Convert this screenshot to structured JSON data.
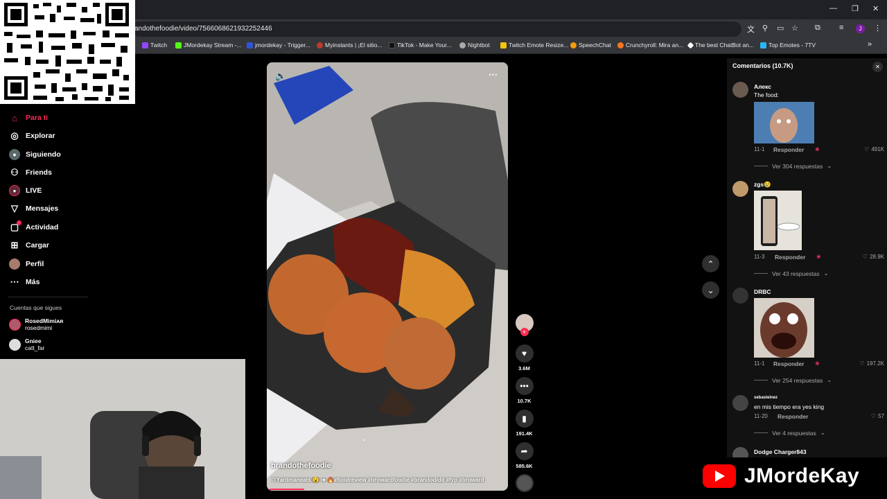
{
  "browser": {
    "url": "andothefoodie/video/7566068621932252446",
    "bookmarks": [
      {
        "label": "Twitch",
        "color": "#9146ff"
      },
      {
        "label": "JMordekay Stream -...",
        "color": "#53fc18"
      },
      {
        "label": "jmordekay - Trigger...",
        "color": "#2f55d4"
      },
      {
        "label": "Myinstants | ¡El sitio...",
        "color": "#c0392b"
      },
      {
        "label": "TikTok - Make Your...",
        "color": "#111111"
      },
      {
        "label": "Nightbot",
        "color": "#aaaaaa"
      },
      {
        "label": "Twitch Emote Resize...",
        "color": "#f1c40f"
      },
      {
        "label": "SpeechChat",
        "color": "#f39c12"
      },
      {
        "label": "Crunchyroll: Mira an...",
        "color": "#f47521"
      },
      {
        "label": "The best ChatBot an...",
        "color": "#ffffff"
      },
      {
        "label": "Top Emotes - 7TV",
        "color": "#29b6f6"
      }
    ],
    "profile_initial": "J"
  },
  "sidebar": {
    "items": [
      {
        "label": "Para ti",
        "icon": "home-icon"
      },
      {
        "label": "Explorar",
        "icon": "compass-icon"
      },
      {
        "label": "Siguiendo",
        "icon": "following-icon"
      },
      {
        "label": "Friends",
        "icon": "friends-icon"
      },
      {
        "label": "LIVE",
        "icon": "live-icon"
      },
      {
        "label": "Mensajes",
        "icon": "messages-icon"
      },
      {
        "label": "Actividad",
        "icon": "activity-icon"
      },
      {
        "label": "Cargar",
        "icon": "upload-icon"
      },
      {
        "label": "Perfil",
        "icon": "profile-icon"
      },
      {
        "label": "Más",
        "icon": "more-icon"
      }
    ],
    "following_title": "Cuentas que sigues",
    "following": [
      {
        "name": "RosedMimiᴀʀ",
        "handle": "rosedmimi"
      },
      {
        "name": "Gniee",
        "handle": "catt_far"
      }
    ]
  },
  "video": {
    "author": "brandothefoodie",
    "caption": "@Yardmaneats 😮 ➜ 🔥#foodreview #browardfoodie #brandodidit #fyp #broward",
    "likes": "3.6M",
    "comments": "10.7K",
    "saves": "191.4K",
    "shares": "585.6K"
  },
  "comments_panel": {
    "title": "Comentarios (10.7K)",
    "reply_label": "Responder",
    "items": [
      {
        "name": "Алекс",
        "text": "The food:",
        "date": "11-1",
        "likes": "491K",
        "more": "Ver 304 respuestas"
      },
      {
        "name": "zgs😢",
        "text": "",
        "date": "11-3",
        "likes": "28.9K",
        "more": "Ver 43 respuestas"
      },
      {
        "name": "DRBC",
        "text": "",
        "date": "11-1",
        "likes": "197.2K",
        "more": "Ver 254 respuestas"
      },
      {
        "name": "sebasteinez",
        "text": "en mis tiempo era yes king",
        "date": "11-20",
        "likes": "57",
        "more": "Ver 4 respuestas"
      },
      {
        "name": "Dodge Charger843",
        "text": "",
        "date": "",
        "likes": "",
        "more": ""
      }
    ]
  },
  "overlay": {
    "channel": "JMordeKay"
  }
}
